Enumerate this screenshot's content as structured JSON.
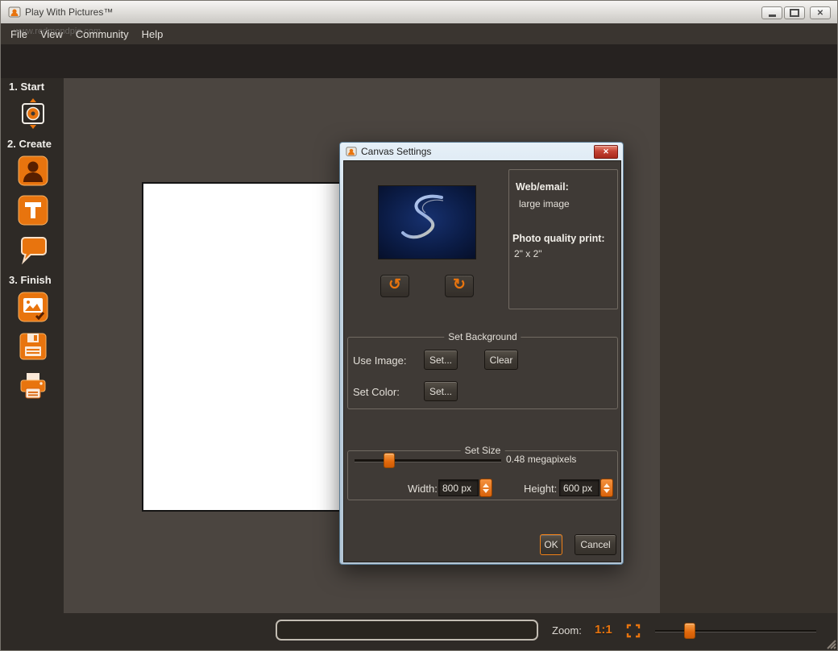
{
  "window": {
    "title": "Play With Pictures™"
  },
  "watermark": "www.redmondpie.com",
  "menu": {
    "file": "File",
    "view": "View",
    "community": "Community",
    "help": "Help"
  },
  "sidebar": {
    "step1": "1. Start",
    "step2": "2. Create",
    "step3": "3. Finish"
  },
  "dialog": {
    "title": "Canvas Settings",
    "info": {
      "web_label": "Web/email:",
      "web_value": "large image",
      "print_label": "Photo quality print:",
      "print_value": "2\" x 2\""
    },
    "background": {
      "legend": "Set Background",
      "use_image_label": "Use Image:",
      "set_button": "Set...",
      "clear_button": "Clear",
      "set_color_label": "Set Color:",
      "set_color_button": "Set..."
    },
    "size": {
      "legend": "Set Size",
      "megapixels": "0.48 megapixels",
      "width_label": "Width:",
      "width_value": "800 px",
      "height_label": "Height:",
      "height_value": "600 px"
    },
    "ok_button": "OK",
    "cancel_button": "Cancel"
  },
  "statusbar": {
    "zoom_label": "Zoom:",
    "one_to_one": "1:1",
    "text_value": ""
  },
  "icons": {
    "close_glyph": "✕",
    "rotate_ccw": "↺",
    "rotate_cw": "↻"
  },
  "colors": {
    "accent": "#e8740e",
    "canvas_bg": "#4b4540",
    "dialog_bg": "#3f3a36"
  }
}
